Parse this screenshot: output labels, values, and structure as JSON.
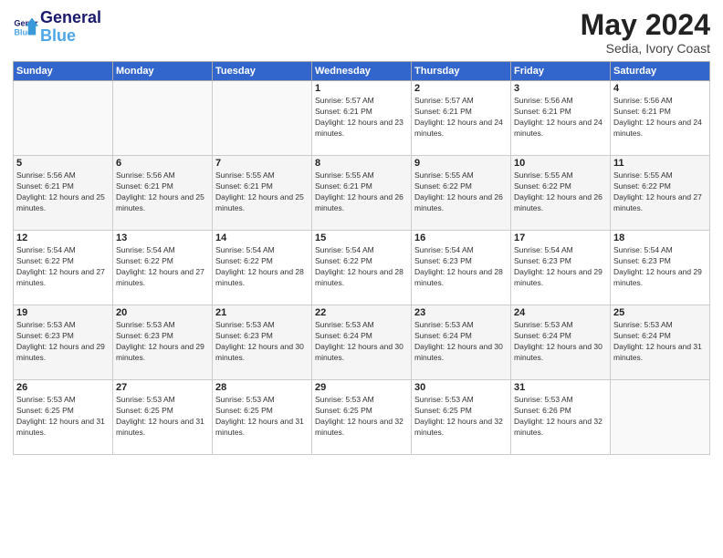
{
  "logo": {
    "line1": "General",
    "line2": "Blue"
  },
  "title": "May 2024",
  "location": "Sedia, Ivory Coast",
  "days_of_week": [
    "Sunday",
    "Monday",
    "Tuesday",
    "Wednesday",
    "Thursday",
    "Friday",
    "Saturday"
  ],
  "weeks": [
    [
      {
        "day": "",
        "sunrise": "",
        "sunset": "",
        "daylight": ""
      },
      {
        "day": "",
        "sunrise": "",
        "sunset": "",
        "daylight": ""
      },
      {
        "day": "",
        "sunrise": "",
        "sunset": "",
        "daylight": ""
      },
      {
        "day": "1",
        "sunrise": "Sunrise: 5:57 AM",
        "sunset": "Sunset: 6:21 PM",
        "daylight": "Daylight: 12 hours and 23 minutes."
      },
      {
        "day": "2",
        "sunrise": "Sunrise: 5:57 AM",
        "sunset": "Sunset: 6:21 PM",
        "daylight": "Daylight: 12 hours and 24 minutes."
      },
      {
        "day": "3",
        "sunrise": "Sunrise: 5:56 AM",
        "sunset": "Sunset: 6:21 PM",
        "daylight": "Daylight: 12 hours and 24 minutes."
      },
      {
        "day": "4",
        "sunrise": "Sunrise: 5:56 AM",
        "sunset": "Sunset: 6:21 PM",
        "daylight": "Daylight: 12 hours and 24 minutes."
      }
    ],
    [
      {
        "day": "5",
        "sunrise": "Sunrise: 5:56 AM",
        "sunset": "Sunset: 6:21 PM",
        "daylight": "Daylight: 12 hours and 25 minutes."
      },
      {
        "day": "6",
        "sunrise": "Sunrise: 5:56 AM",
        "sunset": "Sunset: 6:21 PM",
        "daylight": "Daylight: 12 hours and 25 minutes."
      },
      {
        "day": "7",
        "sunrise": "Sunrise: 5:55 AM",
        "sunset": "Sunset: 6:21 PM",
        "daylight": "Daylight: 12 hours and 25 minutes."
      },
      {
        "day": "8",
        "sunrise": "Sunrise: 5:55 AM",
        "sunset": "Sunset: 6:21 PM",
        "daylight": "Daylight: 12 hours and 26 minutes."
      },
      {
        "day": "9",
        "sunrise": "Sunrise: 5:55 AM",
        "sunset": "Sunset: 6:22 PM",
        "daylight": "Daylight: 12 hours and 26 minutes."
      },
      {
        "day": "10",
        "sunrise": "Sunrise: 5:55 AM",
        "sunset": "Sunset: 6:22 PM",
        "daylight": "Daylight: 12 hours and 26 minutes."
      },
      {
        "day": "11",
        "sunrise": "Sunrise: 5:55 AM",
        "sunset": "Sunset: 6:22 PM",
        "daylight": "Daylight: 12 hours and 27 minutes."
      }
    ],
    [
      {
        "day": "12",
        "sunrise": "Sunrise: 5:54 AM",
        "sunset": "Sunset: 6:22 PM",
        "daylight": "Daylight: 12 hours and 27 minutes."
      },
      {
        "day": "13",
        "sunrise": "Sunrise: 5:54 AM",
        "sunset": "Sunset: 6:22 PM",
        "daylight": "Daylight: 12 hours and 27 minutes."
      },
      {
        "day": "14",
        "sunrise": "Sunrise: 5:54 AM",
        "sunset": "Sunset: 6:22 PM",
        "daylight": "Daylight: 12 hours and 28 minutes."
      },
      {
        "day": "15",
        "sunrise": "Sunrise: 5:54 AM",
        "sunset": "Sunset: 6:22 PM",
        "daylight": "Daylight: 12 hours and 28 minutes."
      },
      {
        "day": "16",
        "sunrise": "Sunrise: 5:54 AM",
        "sunset": "Sunset: 6:23 PM",
        "daylight": "Daylight: 12 hours and 28 minutes."
      },
      {
        "day": "17",
        "sunrise": "Sunrise: 5:54 AM",
        "sunset": "Sunset: 6:23 PM",
        "daylight": "Daylight: 12 hours and 29 minutes."
      },
      {
        "day": "18",
        "sunrise": "Sunrise: 5:54 AM",
        "sunset": "Sunset: 6:23 PM",
        "daylight": "Daylight: 12 hours and 29 minutes."
      }
    ],
    [
      {
        "day": "19",
        "sunrise": "Sunrise: 5:53 AM",
        "sunset": "Sunset: 6:23 PM",
        "daylight": "Daylight: 12 hours and 29 minutes."
      },
      {
        "day": "20",
        "sunrise": "Sunrise: 5:53 AM",
        "sunset": "Sunset: 6:23 PM",
        "daylight": "Daylight: 12 hours and 29 minutes."
      },
      {
        "day": "21",
        "sunrise": "Sunrise: 5:53 AM",
        "sunset": "Sunset: 6:23 PM",
        "daylight": "Daylight: 12 hours and 30 minutes."
      },
      {
        "day": "22",
        "sunrise": "Sunrise: 5:53 AM",
        "sunset": "Sunset: 6:24 PM",
        "daylight": "Daylight: 12 hours and 30 minutes."
      },
      {
        "day": "23",
        "sunrise": "Sunrise: 5:53 AM",
        "sunset": "Sunset: 6:24 PM",
        "daylight": "Daylight: 12 hours and 30 minutes."
      },
      {
        "day": "24",
        "sunrise": "Sunrise: 5:53 AM",
        "sunset": "Sunset: 6:24 PM",
        "daylight": "Daylight: 12 hours and 30 minutes."
      },
      {
        "day": "25",
        "sunrise": "Sunrise: 5:53 AM",
        "sunset": "Sunset: 6:24 PM",
        "daylight": "Daylight: 12 hours and 31 minutes."
      }
    ],
    [
      {
        "day": "26",
        "sunrise": "Sunrise: 5:53 AM",
        "sunset": "Sunset: 6:25 PM",
        "daylight": "Daylight: 12 hours and 31 minutes."
      },
      {
        "day": "27",
        "sunrise": "Sunrise: 5:53 AM",
        "sunset": "Sunset: 6:25 PM",
        "daylight": "Daylight: 12 hours and 31 minutes."
      },
      {
        "day": "28",
        "sunrise": "Sunrise: 5:53 AM",
        "sunset": "Sunset: 6:25 PM",
        "daylight": "Daylight: 12 hours and 31 minutes."
      },
      {
        "day": "29",
        "sunrise": "Sunrise: 5:53 AM",
        "sunset": "Sunset: 6:25 PM",
        "daylight": "Daylight: 12 hours and 32 minutes."
      },
      {
        "day": "30",
        "sunrise": "Sunrise: 5:53 AM",
        "sunset": "Sunset: 6:25 PM",
        "daylight": "Daylight: 12 hours and 32 minutes."
      },
      {
        "day": "31",
        "sunrise": "Sunrise: 5:53 AM",
        "sunset": "Sunset: 6:26 PM",
        "daylight": "Daylight: 12 hours and 32 minutes."
      },
      {
        "day": "",
        "sunrise": "",
        "sunset": "",
        "daylight": ""
      }
    ]
  ]
}
